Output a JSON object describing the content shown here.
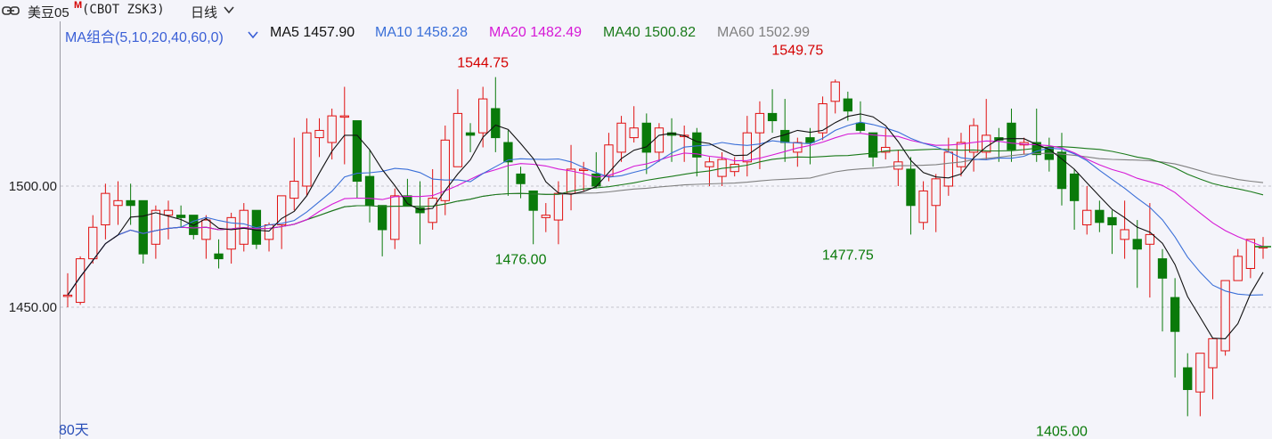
{
  "header": {
    "link_icon": "link-icon",
    "symbol_name": "美豆05",
    "symbol_flag": "M",
    "symbol_code": "(CBOT ZSK3)",
    "period": "日线",
    "period_icon": "chevron-down-icon"
  },
  "ma_legend": {
    "combo_label": "MA组合(5,10,20,40,60,0)",
    "combo_icon": "chevron-down-icon",
    "items": [
      {
        "label": "MA5 1457.90",
        "color": "#111111"
      },
      {
        "label": "MA10 1458.28",
        "color": "#3a6fd8"
      },
      {
        "label": "MA20 1482.49",
        "color": "#d61ad6"
      },
      {
        "label": "MA40 1500.82",
        "color": "#1a7a1a"
      },
      {
        "label": "MA60 1502.99",
        "color": "#808080"
      }
    ]
  },
  "footer": {
    "days_label": "80天"
  },
  "colors": {
    "up": "#e01010",
    "down": "#0a7a0a",
    "background": "#f4f4fa"
  },
  "chart_data": {
    "type": "candlestick",
    "y_ticks": [
      "1500.00",
      "1450.00"
    ],
    "y_tick_values": [
      1500,
      1450
    ],
    "ylim": [
      1397,
      1562
    ],
    "annotations": [
      {
        "index": 33,
        "value": 1544.75,
        "label": "1544.75",
        "kind": "high"
      },
      {
        "index": 36,
        "value": 1476.0,
        "label": "1476.00",
        "kind": "low"
      },
      {
        "index": 58,
        "value": 1549.75,
        "label": "1549.75",
        "kind": "high"
      },
      {
        "index": 62,
        "value": 1477.75,
        "label": "1477.75",
        "kind": "low"
      },
      {
        "index": 79,
        "value": 1405.0,
        "label": "1405.00",
        "kind": "low"
      }
    ],
    "ohlc": [
      [
        1455,
        1464,
        1450,
        1455
      ],
      [
        1452,
        1471,
        1451,
        1470
      ],
      [
        1470,
        1488,
        1468,
        1483
      ],
      [
        1484,
        1501,
        1478,
        1497
      ],
      [
        1492,
        1502,
        1484,
        1494
      ],
      [
        1494,
        1501,
        1484,
        1492
      ],
      [
        1494,
        1493,
        1468,
        1472
      ],
      [
        1476,
        1492,
        1470,
        1490
      ],
      [
        1488,
        1494,
        1478,
        1490
      ],
      [
        1488,
        1492,
        1483,
        1487
      ],
      [
        1488,
        1488,
        1478,
        1480
      ],
      [
        1478,
        1488,
        1470,
        1486
      ],
      [
        1472,
        1478,
        1466,
        1470
      ],
      [
        1474,
        1489,
        1468,
        1487
      ],
      [
        1476,
        1493,
        1473,
        1490
      ],
      [
        1490,
        1489,
        1474,
        1476
      ],
      [
        1478,
        1485,
        1473,
        1484
      ],
      [
        1484,
        1491,
        1474,
        1496
      ],
      [
        1495,
        1520,
        1490,
        1502
      ],
      [
        1500,
        1528,
        1496,
        1522
      ],
      [
        1520,
        1528,
        1512,
        1523
      ],
      [
        1518,
        1532,
        1511,
        1529
      ],
      [
        1529,
        1541,
        1509,
        1529
      ],
      [
        1527,
        1525,
        1495,
        1502
      ],
      [
        1504,
        1515,
        1485,
        1492
      ],
      [
        1492,
        1487,
        1471,
        1482
      ],
      [
        1478,
        1499,
        1474,
        1496
      ],
      [
        1496,
        1503,
        1493,
        1492
      ],
      [
        1491,
        1502,
        1476,
        1489
      ],
      [
        1485,
        1507,
        1482,
        1495
      ],
      [
        1494,
        1525,
        1488,
        1519
      ],
      [
        1508,
        1540,
        1510,
        1530
      ],
      [
        1522,
        1526,
        1514,
        1521
      ],
      [
        1522,
        1541,
        1516,
        1536
      ],
      [
        1532,
        1545,
        1514,
        1520
      ],
      [
        1518,
        1523,
        1496,
        1510
      ],
      [
        1505,
        1508,
        1495,
        1501
      ],
      [
        1498,
        1497,
        1476,
        1490
      ],
      [
        1487,
        1493,
        1481,
        1488
      ],
      [
        1486,
        1502,
        1476,
        1497
      ],
      [
        1497,
        1517,
        1490,
        1507
      ],
      [
        1507,
        1510,
        1498,
        1507
      ],
      [
        1505,
        1514,
        1499,
        1500
      ],
      [
        1504,
        1522,
        1502,
        1517
      ],
      [
        1514,
        1529,
        1510,
        1526
      ],
      [
        1520,
        1533,
        1518,
        1524
      ],
      [
        1526,
        1530,
        1505,
        1514
      ],
      [
        1514,
        1526,
        1510,
        1524
      ],
      [
        1522,
        1528,
        1510,
        1521
      ],
      [
        1521,
        1525,
        1510,
        1521
      ],
      [
        1522,
        1524,
        1504,
        1512
      ],
      [
        1508,
        1512,
        1500,
        1510
      ],
      [
        1504,
        1514,
        1500,
        1511
      ],
      [
        1506,
        1512,
        1504,
        1509
      ],
      [
        1510,
        1529,
        1504,
        1522
      ],
      [
        1522,
        1535,
        1507,
        1530
      ],
      [
        1530,
        1540,
        1522,
        1527
      ],
      [
        1523,
        1536,
        1510,
        1518
      ],
      [
        1514,
        1520,
        1508,
        1518
      ],
      [
        1520,
        1524,
        1509,
        1518
      ],
      [
        1522,
        1537,
        1519,
        1534
      ],
      [
        1535,
        1544,
        1530,
        1543
      ],
      [
        1536,
        1539,
        1527,
        1531
      ],
      [
        1526,
        1535,
        1522,
        1523
      ],
      [
        1522,
        1520,
        1508,
        1512
      ],
      [
        1514,
        1524,
        1511,
        1516
      ],
      [
        1507,
        1515,
        1500,
        1510
      ],
      [
        1507,
        1512,
        1480,
        1492
      ],
      [
        1485,
        1502,
        1482,
        1498
      ],
      [
        1492,
        1505,
        1481,
        1503
      ],
      [
        1500,
        1520,
        1496,
        1514
      ],
      [
        1508,
        1522,
        1504,
        1518
      ],
      [
        1514,
        1528,
        1506,
        1525
      ],
      [
        1514,
        1536,
        1511,
        1521
      ],
      [
        1520,
        1524,
        1510,
        1519
      ],
      [
        1526,
        1532,
        1510,
        1515
      ],
      [
        1517,
        1520,
        1513,
        1518
      ],
      [
        1518,
        1532,
        1510,
        1513
      ],
      [
        1516,
        1520,
        1506,
        1511
      ],
      [
        1514,
        1522,
        1492,
        1499
      ],
      [
        1505,
        1507,
        1482,
        1494
      ],
      [
        1484,
        1500,
        1480,
        1490
      ],
      [
        1490,
        1494,
        1481,
        1485
      ],
      [
        1487,
        1490,
        1472,
        1484
      ],
      [
        1478,
        1494,
        1470,
        1482
      ],
      [
        1478,
        1486,
        1458,
        1474
      ],
      [
        1476,
        1493,
        1454,
        1480
      ],
      [
        1470,
        1474,
        1440,
        1462
      ],
      [
        1454,
        1462,
        1421,
        1440
      ],
      [
        1425,
        1431,
        1405,
        1416
      ],
      [
        1415,
        1428,
        1405,
        1431
      ],
      [
        1425,
        1436,
        1412,
        1437
      ],
      [
        1432,
        1459,
        1430,
        1461
      ],
      [
        1461,
        1474,
        1462,
        1471
      ],
      [
        1466,
        1478,
        1462,
        1478
      ],
      [
        1475,
        1479,
        1470,
        1475
      ]
    ]
  }
}
